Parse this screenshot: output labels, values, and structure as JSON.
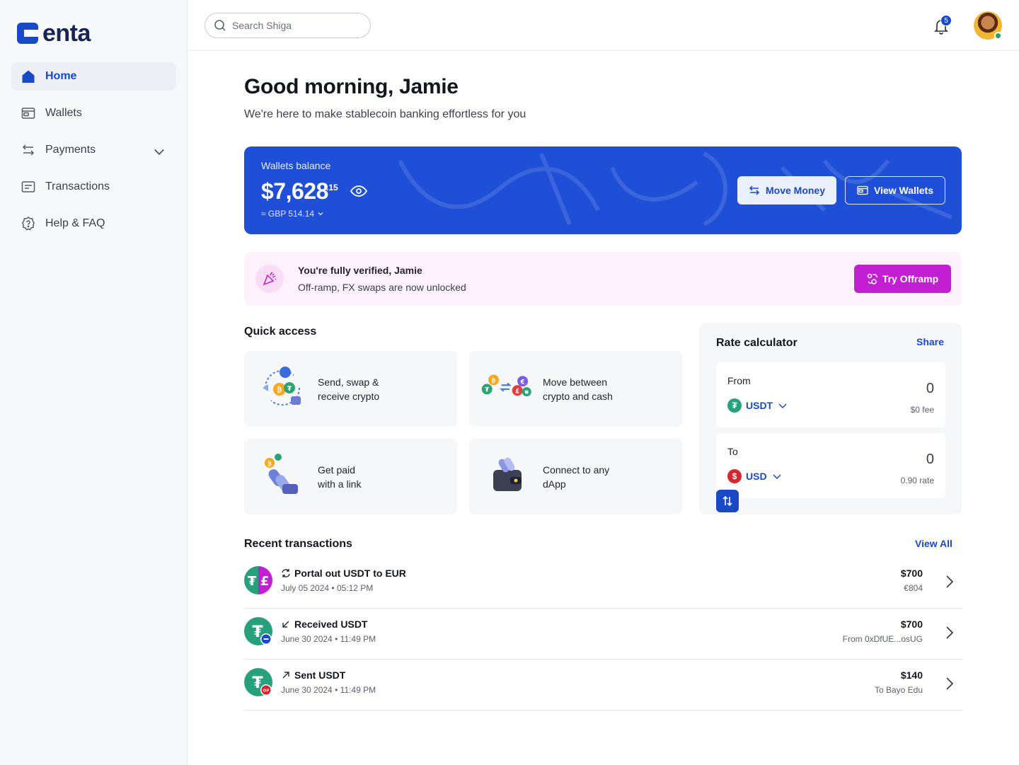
{
  "brand": {
    "name": "enta",
    "accent": "#1a49c8",
    "card": "#1f4fd6",
    "offramp": "#c21fd3"
  },
  "sidebar": {
    "items": [
      {
        "label": "Home",
        "icon": "home-icon",
        "active": true
      },
      {
        "label": "Wallets",
        "icon": "wallet-icon"
      },
      {
        "label": "Payments",
        "icon": "arrows-icon",
        "expandable": true
      },
      {
        "label": "Transactions",
        "icon": "receipt-icon"
      },
      {
        "label": "Help & FAQ",
        "icon": "help-icon"
      }
    ]
  },
  "topbar": {
    "search_placeholder": "Search Shiga",
    "notification_count": "5"
  },
  "greeting": {
    "title": "Good morning, Jamie",
    "subtitle": "We're here to make stablecoin banking effortless for you"
  },
  "balance": {
    "label": "Wallets balance",
    "amount": "$7,628",
    "cents": ".15",
    "secondary": "≈ GBP 514.14",
    "move_label": "Move Money",
    "view_label": "View Wallets"
  },
  "verify": {
    "title": "You're fully verified, Jamie",
    "subtitle": "Off-ramp, FX swaps are now unlocked",
    "button": "Try Offramp"
  },
  "quick_access": {
    "title": "Quick access",
    "cards": [
      {
        "line1": "Send, swap &",
        "line2": "receive crypto"
      },
      {
        "line1": "Move between",
        "line2": "crypto and cash"
      },
      {
        "line1": "Get paid",
        "line2": "with a link"
      },
      {
        "line1": "Connect to any",
        "line2": "dApp"
      }
    ]
  },
  "rate": {
    "title": "Rate calculator",
    "share": "Share",
    "from": {
      "label": "From",
      "currency": "USDT",
      "value": "0",
      "note": "$0 fee"
    },
    "to": {
      "label": "To",
      "currency": "USD",
      "value": "0",
      "note": "0.90 rate"
    }
  },
  "recent": {
    "title": "Recent transactions",
    "view_all": "View All",
    "items": [
      {
        "name": "Portal out USDT to EUR",
        "date": "July 05 2024",
        "time": "05:12 PM",
        "amount": "$700",
        "sub": "€804"
      },
      {
        "name": "Received USDT",
        "date": "June 30 2024",
        "time": "11:49 PM",
        "amount": "$700",
        "sub": "From 0xDfUE...osUG"
      },
      {
        "name": "Sent USDT",
        "date": "June 30 2024",
        "time": "11:49 PM",
        "amount": "$140",
        "sub": "To Bayo Edu"
      }
    ]
  }
}
